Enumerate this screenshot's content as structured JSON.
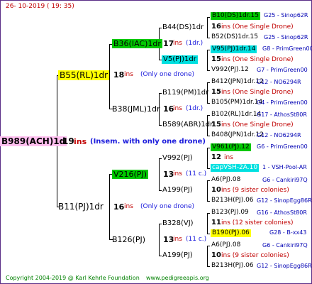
{
  "header": {
    "date": "26- 10-2019 ( 19: 35)"
  },
  "gen0": {
    "id": "B989(ACH)1d",
    "num": "19",
    "ins": "ins",
    "note": "(Insem. with only one drone)"
  },
  "gen1": [
    {
      "id": "B55(RL)1dr",
      "num": "18",
      "ins": "ins",
      "note": "(Only one drone)"
    },
    {
      "id": "B11(PJ)1dr",
      "num": "16",
      "ins": "ins",
      "note": "(Only one drone)"
    }
  ],
  "gen2": [
    {
      "id": "B36(IAC)1dr",
      "num": "17",
      "ins": "ins",
      "note": "(1dr.)"
    },
    {
      "id": "B38(JML)1dr",
      "num": "16",
      "ins": "ins",
      "note": "(1dr.)"
    },
    {
      "id": "V216(PJ)",
      "num": "13",
      "ins": "ins",
      "note": "(11 c.)"
    },
    {
      "id": "B126(PJ)",
      "num": "13",
      "ins": "ins",
      "note": "(11 c.)"
    }
  ],
  "gen3": [
    {
      "id": "B44(DS)1dr"
    },
    {
      "id": "V5(PJ)1dr"
    },
    {
      "id": "B119(PM)1dr"
    },
    {
      "id": "B589(ABR)1dr"
    },
    {
      "id": "V992(PJ)"
    },
    {
      "id": "A199(PJ)"
    },
    {
      "id": "B328(VJ)"
    },
    {
      "id": "A199(PJ)"
    }
  ],
  "gen3_info": [
    {
      "num": "16",
      "text": "ins (One Single Drone)"
    },
    {
      "num": "15",
      "text": "ins (One Single Drone)"
    },
    {
      "num": "15",
      "text": "ins (One Single Drone)"
    },
    {
      "num": "15",
      "text": "ins (One Single Drone)"
    },
    {
      "num": "12",
      "text": "ins"
    },
    {
      "num": "10",
      "text": "ins (9 sister colonies)"
    },
    {
      "num": "11",
      "text": "ins (12 sister colonies)"
    },
    {
      "num": "10",
      "text": "ins (9 sister colonies)"
    }
  ],
  "gen4": [
    {
      "id": "B10(DS)1dr.15",
      "line": "G25 - Sinop62R"
    },
    {
      "id": "B52(DS)1dr.15",
      "line": "G25 - Sinop62R"
    },
    {
      "id": "V95(PJ)1dr.14",
      "line": "G8 - PrimGreen00"
    },
    {
      "id": "V992(PJ).12",
      "line": "G7 - PrimGreen00"
    },
    {
      "id": "B412(JPN)1dr.12",
      "line": "G12 - NO6294R"
    },
    {
      "id": "B105(PM)1dr.14",
      "line": "G4 - PrimGreen00"
    },
    {
      "id": "B102(RL)1dr.14",
      "line": "G17 - AthosSt80R"
    },
    {
      "id": "B408(JPN)1dr.12",
      "line": "G12 - NO6294R"
    },
    {
      "id": "V961(PJ).12",
      "line": "G6 - PrimGreen00"
    },
    {
      "id": "capVSH-2A.10",
      "line": "1 - VSH-Pool-AR"
    },
    {
      "id": "A6(PJ).08",
      "line": "G6 - Cankiri97Q"
    },
    {
      "id": "B213H(PJ).06",
      "line": "G12 - SinopEgg86R"
    },
    {
      "id": "B123(PJ).09",
      "line": "G16 - AthosSt80R"
    },
    {
      "id": "B190(PJ).06",
      "line": "G28 - B-xx43"
    },
    {
      "id": "A6(PJ).08",
      "line": "G6 - Cankiri97Q"
    },
    {
      "id": "B213H(PJ).06",
      "line": "G12 - SinopEgg86R"
    }
  ],
  "footer": {
    "copyright": "Copyright 2004-2019 @ Karl Kehrle Foundation",
    "site": "www.pedigreeapis.org"
  }
}
